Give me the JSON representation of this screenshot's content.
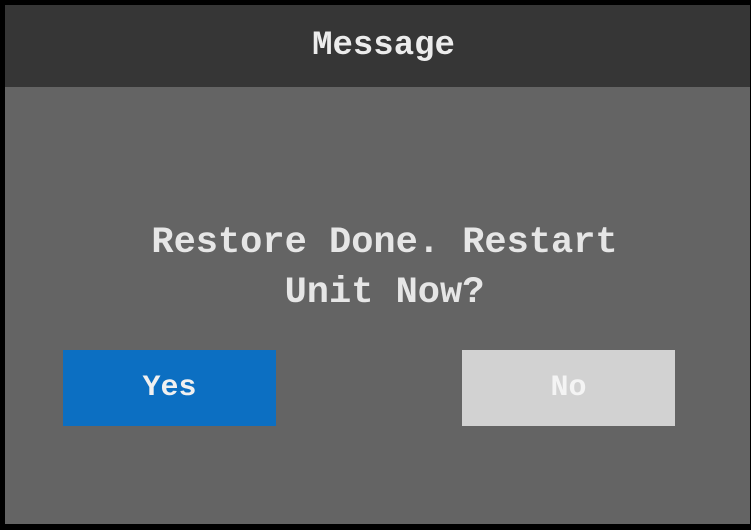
{
  "dialog": {
    "title": "Message",
    "message_line1": "Restore Done. Restart",
    "message_line2": "Unit Now?",
    "yes_label": "Yes",
    "no_label": "No"
  },
  "colors": {
    "background": "#000000",
    "dialog_body": "#646464",
    "title_bar": "#363636",
    "yes_button": "#0c6fc2",
    "no_button_disabled": "#d2d2d2"
  }
}
